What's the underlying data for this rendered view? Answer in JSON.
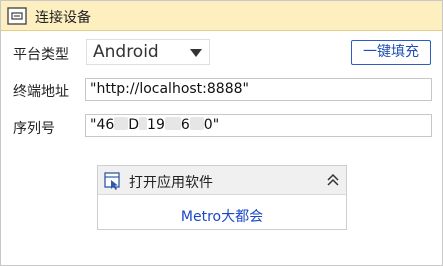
{
  "panel": {
    "title": "连接设备",
    "icon": "device-connect-icon"
  },
  "form": {
    "platform_label": "平台类型",
    "platform_value": "Android",
    "autofill_label": "一键填充",
    "address_label": "终端地址",
    "address_value": "\"http://localhost:8888\"",
    "serial_label": "序列号",
    "serial_parts": [
      "\"46",
      "D",
      "19",
      "6",
      "0\""
    ]
  },
  "subpanel": {
    "title": "打开应用软件",
    "icon": "open-app-icon",
    "app_name": "Metro大都会"
  }
}
